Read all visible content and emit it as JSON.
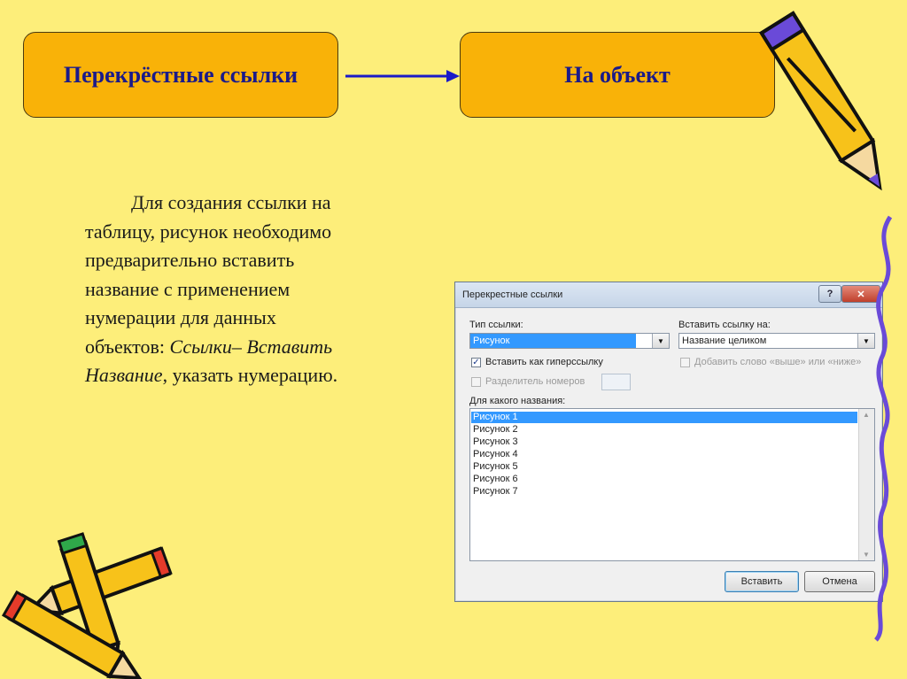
{
  "slide": {
    "left_box": "Перекрёстные ссылки",
    "right_box": "На объект",
    "paragraph": {
      "line1": "Для создания ссылки на",
      "line2": "таблицу, рисунок необходимо",
      "line3": "предварительно вставить",
      "line4": "название с применением",
      "line5": "нумерации для данных",
      "line6_start": "объектов: ",
      "line6_italic": "Ссылки– Вставить",
      "line7_italic": "Название",
      "line7_end": ", указать нумерацию."
    }
  },
  "dialog": {
    "title": "Перекрестные ссылки",
    "help": "?",
    "close": "✕",
    "type_label": "Тип ссылки:",
    "type_value": "Рисунок",
    "insert_to_label": "Вставить ссылку на:",
    "insert_to_value": "Название целиком",
    "hyperlink_label": "Вставить как гиперссылку",
    "hyperlink_checked": true,
    "above_below_label": "Добавить слово «выше» или «ниже»",
    "separator_label": "Разделитель номеров",
    "for_which_label": "Для какого названия:",
    "items": [
      "Рисунок 1",
      "Рисунок 2",
      "Рисунок 3",
      "Рисунок 4",
      "Рисунок 5",
      "Рисунок 6",
      "Рисунок 7"
    ],
    "selected_index": 0,
    "insert_button": "Вставить",
    "cancel_button": "Отмена"
  },
  "colors": {
    "background": "#fdee7a",
    "box_fill": "#f9b208",
    "box_text": "#1a1a8a",
    "arrow": "#1a1ac8",
    "selection": "#3399ff"
  }
}
